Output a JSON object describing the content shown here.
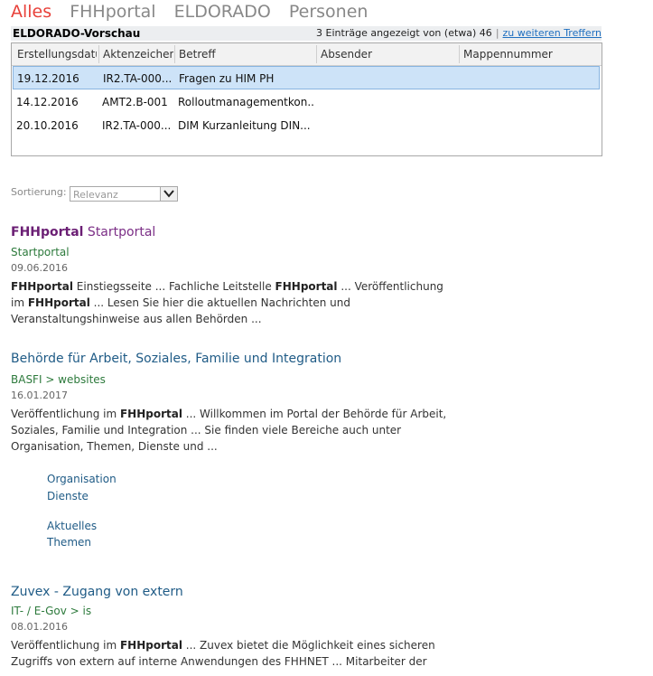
{
  "tabs": [
    {
      "label": "Alles",
      "active": true
    },
    {
      "label": "FHHportal"
    },
    {
      "label": "ELDORADO"
    },
    {
      "label": "Personen"
    }
  ],
  "preview": {
    "title": "ELDORADO-Vorschau",
    "count_text": "3 Einträge angezeigt von (etwa) 46",
    "more_link": "zu weiteren Treffern",
    "columns": [
      "Erstellungsdatum",
      "Aktenzeichen",
      "Betreff",
      "Absender",
      "Mappennummer"
    ],
    "rows": [
      [
        "19.12.2016",
        "IR2.TA-000...",
        "Fragen zu HIM PH",
        "",
        ""
      ],
      [
        "14.12.2016",
        "AMT2.B-001",
        "Rolloutmanagementkon...",
        "",
        ""
      ],
      [
        "20.10.2016",
        "IR2.TA-000...",
        "DIM Kurzanleitung DIN...",
        "",
        ""
      ]
    ]
  },
  "sort": {
    "label": "Sortierung:",
    "value": "Relevanz"
  },
  "results": [
    {
      "title_strong": "FHHportal",
      "title_rest": " Startportal",
      "url": "Startportal",
      "date": "09.06.2016",
      "snippet": "FHHportal Einstiegsseite ... Fachliche Leitstelle FHHportal ... Veröffentlichung im FHHportal ... Lesen Sie hier die aktuellen Nachrichten und Veranstaltungshinweise aus allen Behörden ..."
    },
    {
      "title": "Behörde für Arbeit, Soziales, Familie und Integration",
      "url": "BASFI > websites",
      "date": "16.01.2017",
      "snippet": "Veröffentlichung im FHHportal ... Willkommen im Portal der Behörde für Arbeit, Soziales, Familie und Integration ... Sie finden viele Bereiche auch unter Organisation, Themen, Dienste und ...",
      "sublinks": [
        "Organisation",
        "Dienste",
        "Aktuelles",
        "Themen"
      ]
    },
    {
      "title": "Zuvex - Zugang von extern",
      "url": "IT- / E-Gov > is",
      "date": "08.01.2016",
      "snippet": "Veröffentlichung im FHHportal ... Zuvex bietet die Möglichkeit eines sicheren Zugriffs von extern auf interne Anwendungen des FHHNET ... Mitarbeiter der"
    }
  ]
}
